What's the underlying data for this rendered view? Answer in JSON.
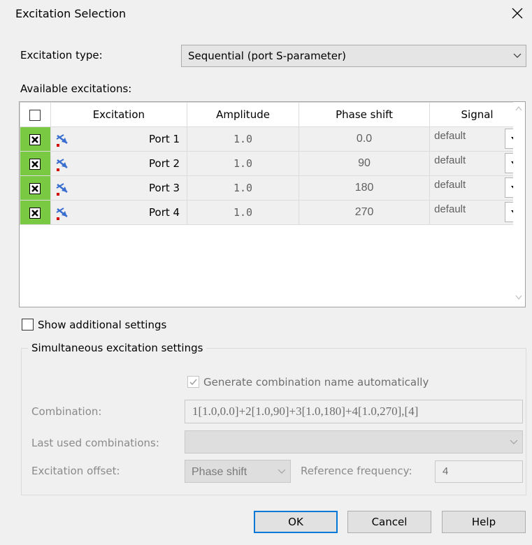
{
  "dialog": {
    "title": "Excitation Selection"
  },
  "excitation_type": {
    "label": "Excitation type:",
    "value": "Sequential (port S-parameter)"
  },
  "available": {
    "label": "Available excitations:",
    "columns": [
      "Excitation",
      "Amplitude",
      "Phase shift",
      "Signal"
    ],
    "rows": [
      {
        "name": "Port 1",
        "amplitude": "1.0",
        "phase": "0.0",
        "signal": "default"
      },
      {
        "name": "Port 2",
        "amplitude": "1.0",
        "phase": "90",
        "signal": "default"
      },
      {
        "name": "Port 3",
        "amplitude": "1.0",
        "phase": "180",
        "signal": "default"
      },
      {
        "name": "Port 4",
        "amplitude": "1.0",
        "phase": "270",
        "signal": "default"
      }
    ]
  },
  "show_additional": {
    "label": "Show additional settings"
  },
  "simultaneous": {
    "title": "Simultaneous excitation settings",
    "generate_label": "Generate combination name automatically",
    "combination_label": "Combination:",
    "combination_value": "1[1.0,0.0]+2[1.0,90]+3[1.0,180]+4[1.0,270],[4]",
    "last_used_label": "Last used combinations:",
    "offset_label": "Excitation offset:",
    "offset_value": "Phase shift",
    "ref_freq_label": "Reference frequency:",
    "ref_freq_value": "4"
  },
  "buttons": {
    "ok": "OK",
    "cancel": "Cancel",
    "help": "Help"
  },
  "colors": {
    "checked_cell": "#7ac943",
    "default_button_border": "#0078d7"
  }
}
